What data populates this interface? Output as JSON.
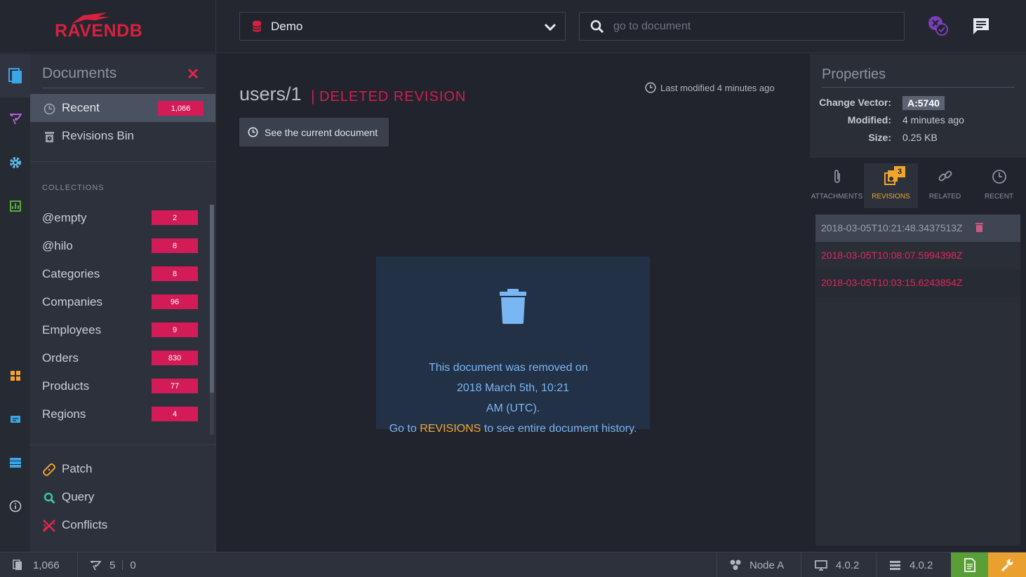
{
  "brand": {
    "logo_text": "RAVENDB"
  },
  "header": {
    "database": {
      "name": "Demo"
    },
    "search": {
      "placeholder": "go to document",
      "value": ""
    }
  },
  "documents_menu": {
    "title": "Documents",
    "items": [
      {
        "label": "Recent",
        "count": "1,066"
      },
      {
        "label": "Revisions Bin"
      }
    ],
    "collections_header": "COLLECTIONS",
    "collections": [
      {
        "label": "@empty",
        "count": "2"
      },
      {
        "label": "@hilo",
        "count": "8"
      },
      {
        "label": "Categories",
        "count": "8"
      },
      {
        "label": "Companies",
        "count": "96"
      },
      {
        "label": "Employees",
        "count": "9"
      },
      {
        "label": "Orders",
        "count": "830"
      },
      {
        "label": "Products",
        "count": "77"
      },
      {
        "label": "Regions",
        "count": "4"
      }
    ],
    "tools": [
      {
        "label": "Patch"
      },
      {
        "label": "Query"
      },
      {
        "label": "Conflicts"
      }
    ]
  },
  "document": {
    "id": "users/1",
    "separator": "|",
    "status_label": "DELETED REVISION",
    "last_modified": "Last modified 4 minutes ago",
    "see_current_label": "See the current document",
    "removed_message_prefix": "This document was removed on",
    "removed_date": "2018 March 5th, 10:21 AM (UTC).",
    "history_prefix": "Go to",
    "history_link": "REVISIONS",
    "history_suffix": "to see entire document history."
  },
  "properties": {
    "title": "Properties",
    "change_vector_label": "Change Vector:",
    "change_vector": "A:5740",
    "modified_label": "Modified:",
    "modified": "4 minutes ago",
    "size_label": "Size:",
    "size": "0.25 KB"
  },
  "tabs": [
    {
      "label": "ATTACHMENTS",
      "icon": "paperclip-icon"
    },
    {
      "label": "REVISIONS",
      "icon": "revisions-icon",
      "badge": "3",
      "active": true
    },
    {
      "label": "RELATED",
      "icon": "link-icon"
    },
    {
      "label": "RECENT",
      "icon": "clock-icon"
    }
  ],
  "revisions": [
    {
      "timestamp": "2018-03-05T10:21:48.3437513Z",
      "state": "current"
    },
    {
      "timestamp": "2018-03-05T10:08:07.5994398Z",
      "state": "deleted"
    },
    {
      "timestamp": "2018-03-05T10:03:15.6243854Z",
      "state": "deleted"
    }
  ],
  "status_bar": {
    "documents_count": "1,066",
    "indexes_count": "5",
    "indexes_errors": "0",
    "node": "Node A",
    "client_version": "4.0.2",
    "server_version": "4.0.2"
  },
  "colors": {
    "accent_red": "#d31b58",
    "accent_orange": "#f2a52d",
    "info_blue": "#78b6f4",
    "panel_blue": "#233147",
    "status_green": "#5a9e38"
  }
}
